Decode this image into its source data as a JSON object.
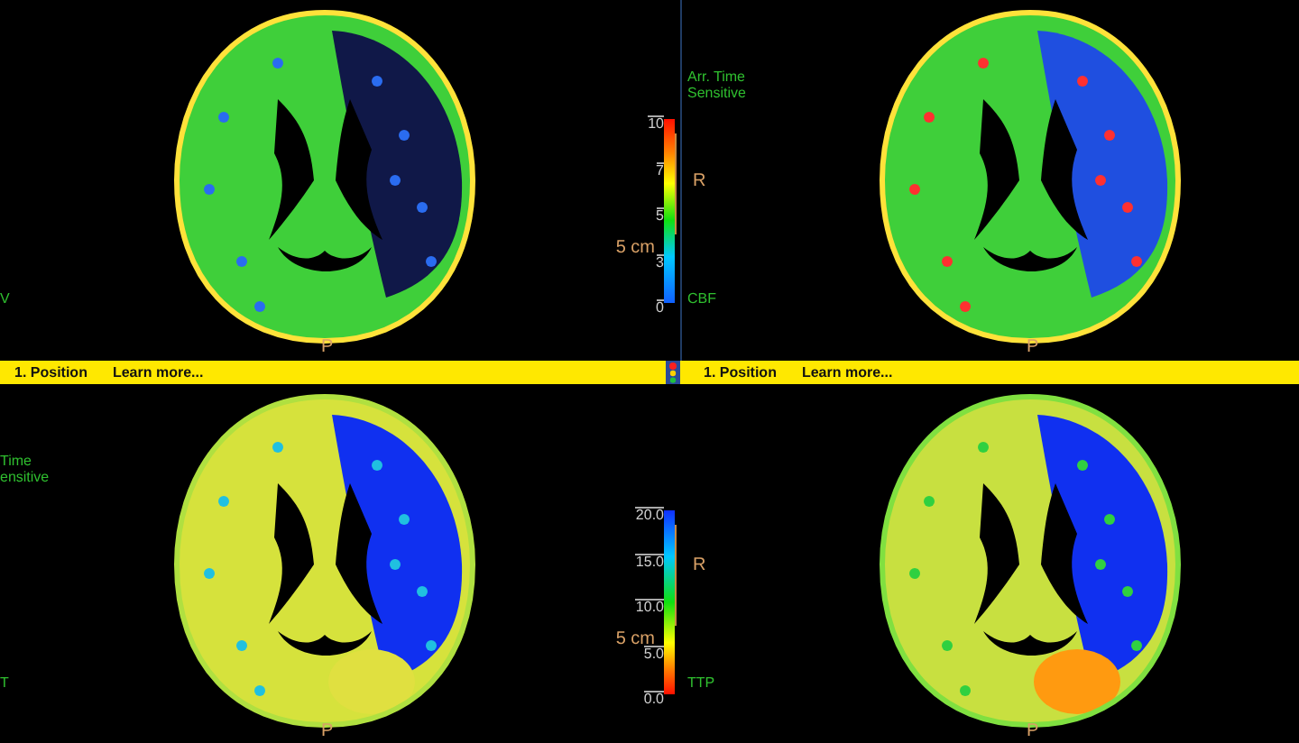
{
  "top_row": {
    "separator": true,
    "left_view": {
      "kind": "cbv",
      "map_label": "V",
      "bottom_label": "P"
    },
    "colorbar": {
      "kind": "ascending",
      "ticks": [
        "10",
        "7",
        "5",
        "3",
        "0"
      ],
      "scale_label": "5 cm"
    },
    "right_view": {
      "kind": "cbf",
      "title_lines": [
        "Arr. Time",
        "Sensitive"
      ],
      "orientation_label": "R",
      "map_label": "CBF",
      "bottom_label": "P"
    }
  },
  "status_bar": {
    "left": {
      "step": "1. Position",
      "link": "Learn more..."
    },
    "right": {
      "step": "1. Position",
      "link": "Learn more..."
    }
  },
  "bottom_row": {
    "separator": false,
    "left_view": {
      "kind": "mtt",
      "title_lines": [
        "Time",
        "ensitive"
      ],
      "map_label": "T",
      "bottom_label": "P"
    },
    "colorbar": {
      "kind": "descending",
      "ticks": [
        "20.0",
        "15.0",
        "10.0",
        "5.0",
        "0.0"
      ],
      "scale_label": "5 cm"
    },
    "right_view": {
      "kind": "ttp",
      "orientation_label": "R",
      "map_label": "TTP",
      "bottom_label": "P"
    }
  }
}
